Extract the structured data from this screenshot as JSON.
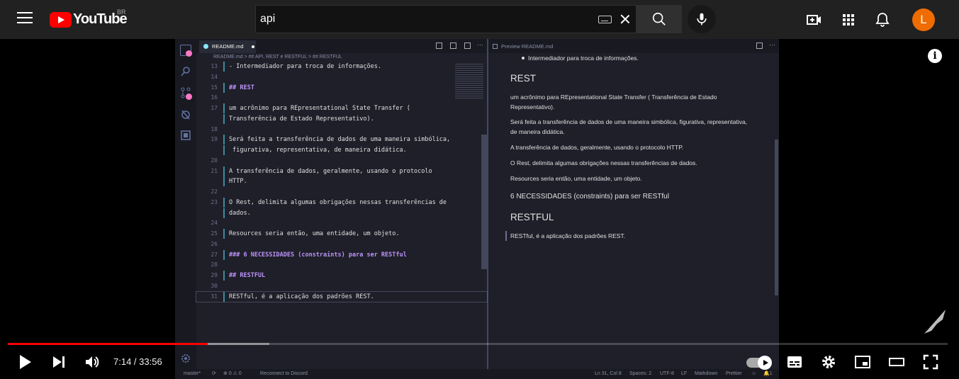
{
  "header": {
    "logo_text": "YouTube",
    "country_code": "BR",
    "search_value": "api",
    "avatar_letter": "L"
  },
  "player": {
    "time_display": "7:14 / 33:56",
    "progress_played_fraction": 0.213,
    "progress_loaded_fraction": 0.278,
    "info_label": "i"
  },
  "video": {
    "editor": {
      "tab_label": "README.md",
      "breadcrumb": "README.md > ## API, REST e RESTFUL > ## RESTFUL",
      "lines": [
        {
          "n": "13",
          "text": "- Intermediador para troca de informações.",
          "style": "normal"
        },
        {
          "n": "14",
          "text": "",
          "style": "normal"
        },
        {
          "n": "15",
          "text": "## REST",
          "style": "heading"
        },
        {
          "n": "16",
          "text": "",
          "style": "normal"
        },
        {
          "n": "17",
          "text": "um acrônimo para REpresentational State Transfer (",
          "style": "normal"
        },
        {
          "n": "",
          "text": "Transferência de Estado Representativo).",
          "style": "normal"
        },
        {
          "n": "18",
          "text": "",
          "style": "normal"
        },
        {
          "n": "19",
          "text": "Será feita a transferência de dados de uma maneira simbólica,",
          "style": "normal"
        },
        {
          "n": "",
          "text": " figurativa, representativa, de maneira didática.",
          "style": "normal"
        },
        {
          "n": "20",
          "text": "",
          "style": "normal"
        },
        {
          "n": "21",
          "text": "A transferência de dados, geralmente, usando o protocolo",
          "style": "normal"
        },
        {
          "n": "",
          "text": "HTTP.",
          "style": "normal"
        },
        {
          "n": "22",
          "text": "",
          "style": "normal"
        },
        {
          "n": "23",
          "text": "O Rest, delimita algumas obrigações nessas transferências de",
          "style": "normal"
        },
        {
          "n": "",
          "text": "dados.",
          "style": "normal"
        },
        {
          "n": "24",
          "text": "",
          "style": "normal"
        },
        {
          "n": "25",
          "text": "Resources seria então, uma entidade, um objeto.",
          "style": "normal"
        },
        {
          "n": "26",
          "text": "",
          "style": "normal"
        },
        {
          "n": "27",
          "text": "### 6 NECESSIDADES (constraints) para ser RESTful",
          "style": "heading"
        },
        {
          "n": "28",
          "text": "",
          "style": "normal"
        },
        {
          "n": "29",
          "text": "## RESTFUL",
          "style": "heading"
        },
        {
          "n": "30",
          "text": "",
          "style": "normal"
        },
        {
          "n": "31",
          "text": "RESTful, é a aplicação dos padrões REST.",
          "style": "normal"
        }
      ]
    },
    "preview": {
      "tab_label": "Preview README.md",
      "bullet": "Intermediador para troca de informações.",
      "h2_rest": "REST",
      "p1": "um acrônimo para REpresentational State Transfer ( Transferência de Estado Representativo).",
      "p2": "Será feita a transferência de dados de uma maneira simbólica, figurativa, representativa, de maneira didática.",
      "p3": "A transferência de dados, geralmente, usando o protocolo HTTP.",
      "p4": "O Rest, delimita algumas obrigações nessas transferências de dados.",
      "p5": "Resources seria então, uma entidade, um objeto.",
      "h3": "6 NECESSIDADES (constraints) para ser RESTful",
      "h2_restful": "RESTFUL",
      "p6": "RESTful, é a aplicação dos padrões REST."
    },
    "statusbar": {
      "branch": "master*",
      "problems": "0 ⚠ 0",
      "discord": "Reconnect to Discord",
      "cursor": "Ln 31, Col 8",
      "spaces": "Spaces: 2",
      "encoding": "UTF-8",
      "eol": "LF",
      "language": "Markdown",
      "formatter": "Prettier"
    }
  }
}
